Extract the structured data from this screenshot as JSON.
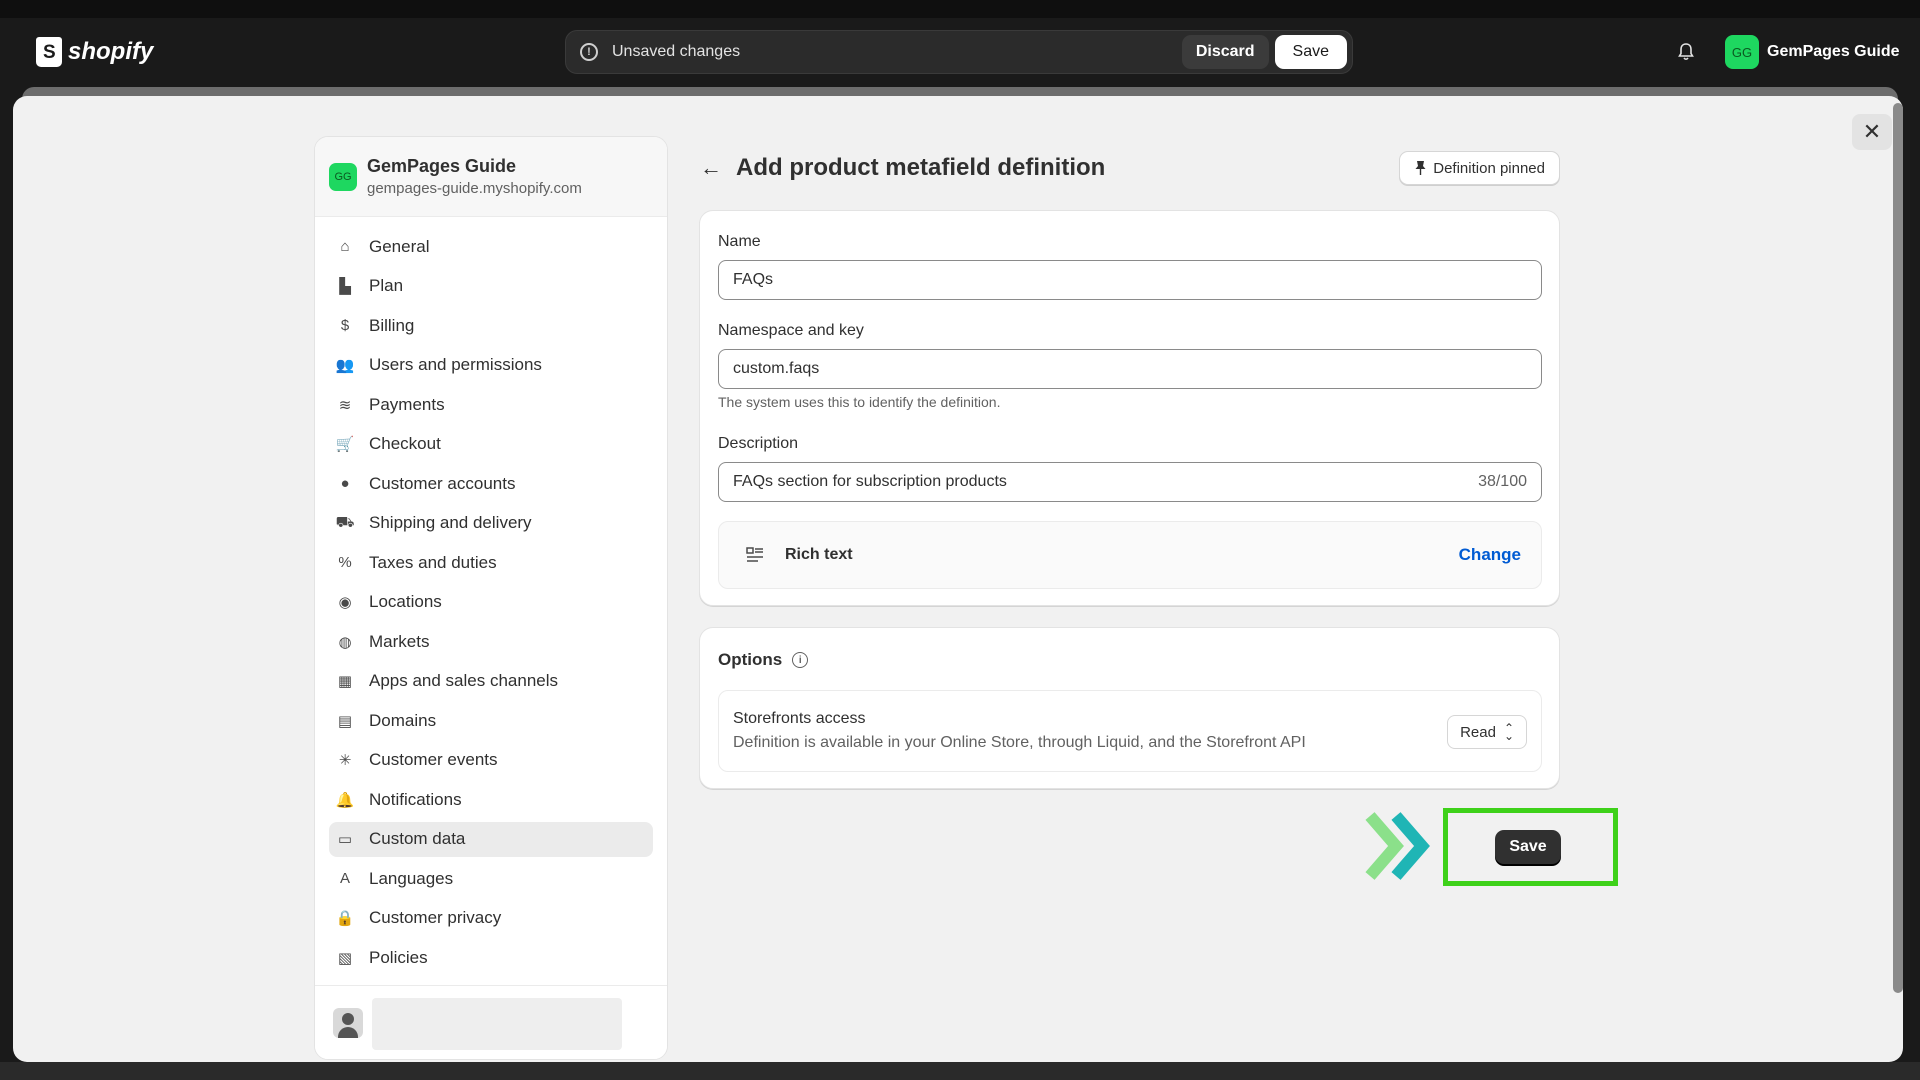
{
  "topbar": {
    "brand": "shopify",
    "unsaved_text": "Unsaved changes",
    "discard_label": "Discard",
    "save_label": "Save",
    "account_initials": "GG",
    "account_name": "GemPages Guide"
  },
  "sidebar": {
    "store_initials": "GG",
    "store_name": "GemPages Guide",
    "store_url": "gempages-guide.myshopify.com",
    "items": [
      {
        "label": "General",
        "icon": "store-icon"
      },
      {
        "label": "Plan",
        "icon": "plan-icon"
      },
      {
        "label": "Billing",
        "icon": "billing-icon"
      },
      {
        "label": "Users and permissions",
        "icon": "users-icon"
      },
      {
        "label": "Payments",
        "icon": "payments-icon"
      },
      {
        "label": "Checkout",
        "icon": "cart-icon"
      },
      {
        "label": "Customer accounts",
        "icon": "person-icon"
      },
      {
        "label": "Shipping and delivery",
        "icon": "truck-icon"
      },
      {
        "label": "Taxes and duties",
        "icon": "taxes-icon"
      },
      {
        "label": "Locations",
        "icon": "location-icon"
      },
      {
        "label": "Markets",
        "icon": "globe-icon"
      },
      {
        "label": "Apps and sales channels",
        "icon": "apps-icon"
      },
      {
        "label": "Domains",
        "icon": "domains-icon"
      },
      {
        "label": "Customer events",
        "icon": "events-icon"
      },
      {
        "label": "Notifications",
        "icon": "bell-icon"
      },
      {
        "label": "Custom data",
        "icon": "custom-data-icon",
        "active": true
      },
      {
        "label": "Languages",
        "icon": "languages-icon"
      },
      {
        "label": "Customer privacy",
        "icon": "lock-icon"
      },
      {
        "label": "Policies",
        "icon": "policies-icon"
      }
    ]
  },
  "main": {
    "title": "Add product metafield definition",
    "pinned_label": "Definition pinned",
    "name_label": "Name",
    "name_value": "FAQs",
    "namespace_label": "Namespace and key",
    "namespace_value": "custom.faqs",
    "namespace_help": "The system uses this to identify the definition.",
    "description_label": "Description",
    "description_value": "FAQs section for subscription products",
    "description_counter": "38/100",
    "type_label": "Rich text",
    "change_label": "Change",
    "options_title": "Options",
    "storefronts_title": "Storefronts access",
    "storefronts_desc": "Definition is available in your Online Store, through Liquid, and the Storefront API",
    "access_value": "Read",
    "save_label": "Save"
  },
  "colors": {
    "highlight": "#3ed11a",
    "chevron_light": "#8be08a",
    "chevron_teal": "#1fb5b5",
    "link": "#005bd3",
    "avatar_green": "#1ed760"
  }
}
